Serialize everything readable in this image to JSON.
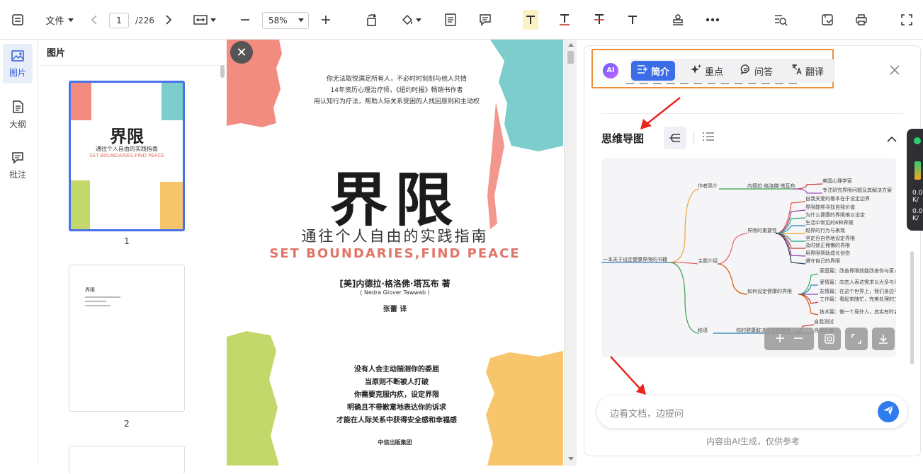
{
  "toolbar": {
    "file_label": "文件",
    "page_current": "1",
    "page_total": "/226",
    "zoom": "58%"
  },
  "leftrail": {
    "items": [
      {
        "label": "图片",
        "icon": "image-icon"
      },
      {
        "label": "大纲",
        "icon": "outline-icon"
      },
      {
        "label": "批注",
        "icon": "comment-icon"
      }
    ]
  },
  "thumbpanel": {
    "title": "图片",
    "pages": [
      "1",
      "2"
    ],
    "thumb2_title": "界限"
  },
  "cover": {
    "quote_lines": [
      "你无法取悦满足所有人，不必时时刻刻与他人共情",
      "14年资历心理治疗师，《纽约时报》畅销书作者",
      "用认知行为疗法，帮助人际关系受困的人找回原则和主动权"
    ],
    "title": "界限",
    "subtitle": "通往个人自由的实践指南",
    "subtitle_en": "SET BOUNDARIES,FIND PEACE",
    "author": "[美]内德拉·格洛佛·塔瓦布 著",
    "author_en": "( Nedra Glover Tawwab )",
    "translator": "张蕾 译",
    "lines": [
      "没有人会主动揣测你的委屈",
      "当原则不断被人打破",
      "你需要克服内疚，设定界限",
      "明确且不带歉意地表达你的诉求",
      "才能在人际关系中获得安全感和幸福感"
    ],
    "publisher": "中信出版集团"
  },
  "ai": {
    "logo_text": "AI",
    "tabs": [
      {
        "label": "简介",
        "icon": "summary-icon",
        "active": true
      },
      {
        "label": "重点",
        "icon": "sparkle-icon",
        "active": false
      },
      {
        "label": "问答",
        "icon": "chat-icon",
        "active": false
      },
      {
        "label": "翻译",
        "icon": "translate-icon",
        "active": false
      }
    ],
    "mindmap_title": "思维导图",
    "mindmap": {
      "root": "一本关于设定健康界限的书籍",
      "branches": [
        "作者简介",
        "主题介绍",
        "结语"
      ],
      "author_child": "内德拉·格洛佛·塔瓦布",
      "author_leaves": [
        "美国心理学家",
        "专注研究界限问题及其解决方案"
      ],
      "theme_children": [
        "界限的重要性",
        "如何设定健康的界限"
      ],
      "importance_leaves": [
        "自我关爱的根本在于设定边界",
        "界限能够寻找自我价值",
        "为什么健康的界限难以设定",
        "生活中常见的6种界限",
        "越界的行为与表现",
        "坚定且自信地设定界限",
        "及时修正佣懒的界限",
        "用界限帮助成长创伤",
        "遵守自己的界限"
      ],
      "howto_leaves": [
        "家庭篇：改善界限就能改善你与家人的关系",
        "爱情篇：向恋人表达需求以大多与沟通有关",
        "友情篇：在这个世界上，我们身边不乏",
        "工作篇：看起来随忙，完美处理的工作",
        "技术篇：做一个局外人，其实有时会让"
      ],
      "ending_child": "你的健康取决于你的界限",
      "ending_leaves": [
        "自我测试",
        "自我反思"
      ]
    },
    "ask_placeholder": "边看文档，边提问",
    "disclaimer": "内容由AI生成，仅供参考"
  },
  "widget": {
    "v1": "0.0",
    "u1": "K/",
    "v2": "0.0",
    "u2": "K/"
  },
  "colors": {
    "accent": "#3a6de6",
    "highlight_border": "#ef8e3a",
    "annotation_arrow": "#e8271f",
    "cover_red": "#f28c80",
    "cover_teal": "#7ccdcb",
    "cover_green": "#c3d86a",
    "cover_orange": "#f7c56c"
  }
}
